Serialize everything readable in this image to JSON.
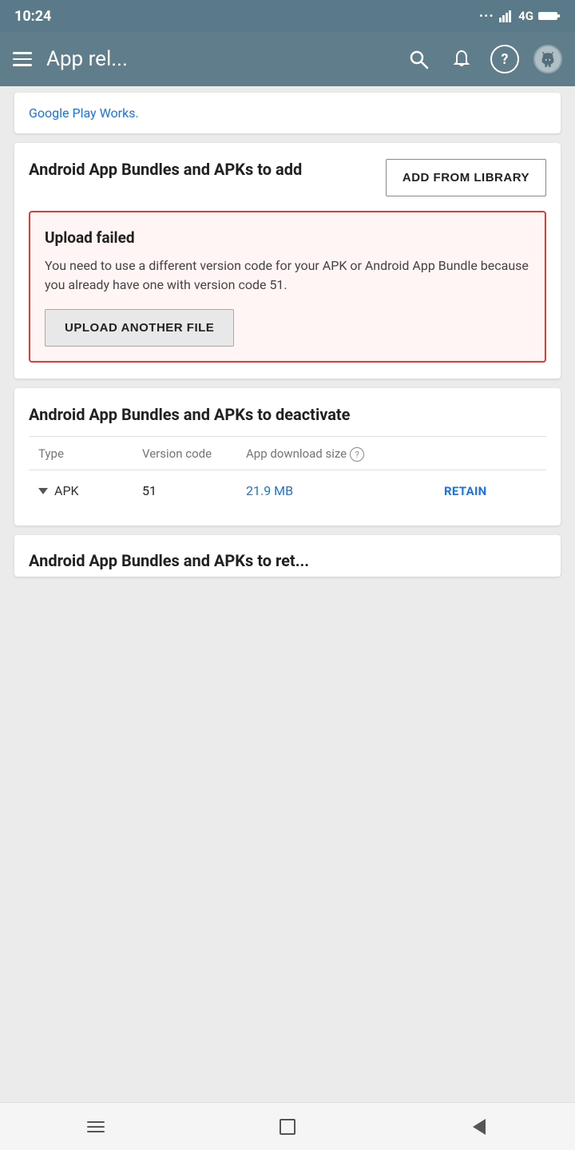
{
  "statusBar": {
    "time": "10:24",
    "signal": "4G",
    "battery": "full"
  },
  "navBar": {
    "title": "App rel...",
    "menuIcon": "≡",
    "searchIcon": "🔍",
    "bellIcon": "🔔",
    "helpIcon": "?"
  },
  "partialCard": {
    "linkText": "Google Play Works."
  },
  "addSection": {
    "label": "Android App Bundles and APKs to add",
    "buttonLabel": "ADD FROM LIBRARY"
  },
  "errorBox": {
    "title": "Upload failed",
    "message": "You need to use a different version code for your APK or Android App Bundle because you already have one with version code 51.",
    "buttonLabel": "UPLOAD ANOTHER FILE"
  },
  "deactivateCard": {
    "title": "Android App Bundles and APKs to deactivate",
    "tableHeaders": {
      "type": "Type",
      "versionCode": "Version code",
      "appDownloadSize": "App download size"
    },
    "tableRows": [
      {
        "type": "APK",
        "versionCode": "51",
        "downloadSize": "21.9 MB",
        "action": "RETAIN"
      }
    ]
  },
  "bottomPartialCard": {
    "title": "Android App Bundles and APKs to ret..."
  },
  "bottomNav": {
    "menuLabel": "menu",
    "homeLabel": "home",
    "backLabel": "back"
  }
}
